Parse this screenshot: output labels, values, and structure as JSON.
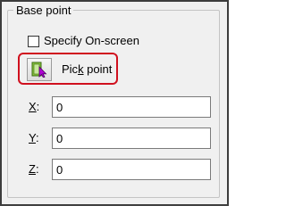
{
  "groupbox": {
    "title": "Base point"
  },
  "specify_onscreen": {
    "label": "Specify On-screen",
    "checked": false
  },
  "pick_point": {
    "label_before": "Pic",
    "label_mnemonic": "k",
    "label_after": " point",
    "icon": "pick-point-icon"
  },
  "coords": {
    "x": {
      "label": "X",
      "suffix": ":",
      "value": "0"
    },
    "y": {
      "label": "Y",
      "suffix": ":",
      "value": "0"
    },
    "z": {
      "label": "Z",
      "suffix": ":",
      "value": "0"
    }
  },
  "colors": {
    "highlight": "#d0101e",
    "panel_background": "#f0f0f0"
  }
}
